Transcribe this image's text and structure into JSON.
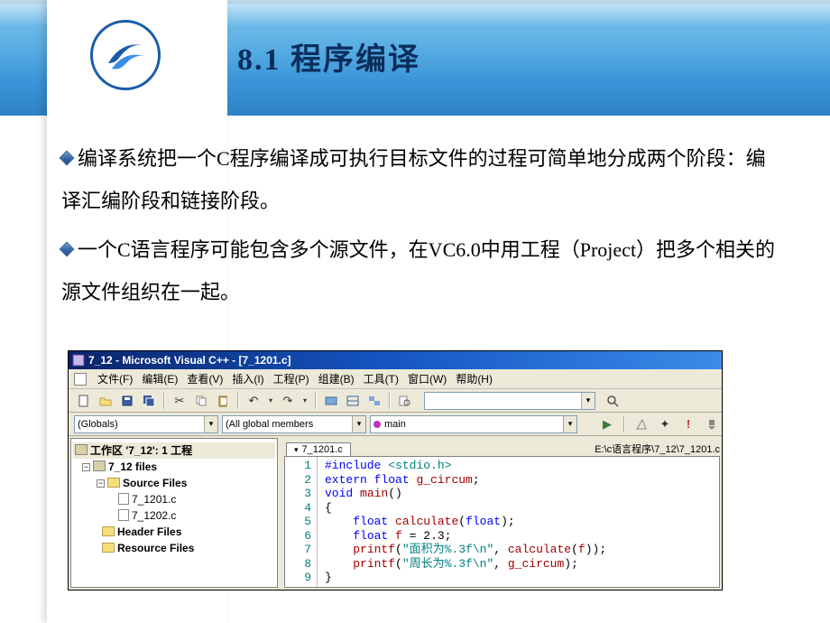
{
  "slide": {
    "title": "8.1 程序编译",
    "bullets": [
      "编译系统把一个C程序编译成可执行目标文件的过程可简单地分成两个阶段：编译汇编阶段和链接阶段。",
      "一个C语言程序可能包含多个源文件，在VC6.0中用工程（Project）把多个相关的源文件组织在一起。"
    ]
  },
  "ide": {
    "title": "7_12 - Microsoft Visual C++ - [7_1201.c]",
    "menus": {
      "file": "文件(F)",
      "edit": "编辑(E)",
      "view": "查看(V)",
      "insert": "插入(I)",
      "project": "工程(P)",
      "build": "组建(B)",
      "tools": "工具(T)",
      "window": "窗口(W)",
      "help": "帮助(H)"
    },
    "combos": {
      "globals": "(Globals)",
      "members": "(All global members",
      "main": "main"
    },
    "editor_tab": "7_1201.c",
    "editor_path": "E:\\c语言程序\\7_12\\7_1201.c",
    "tree": {
      "workspace": "工作区 '7_12': 1 工程",
      "project": "7_12 files",
      "source_folder": "Source Files",
      "file1": "7_1201.c",
      "file2": "7_1202.c",
      "header_folder": "Header Files",
      "resource_folder": "Resource Files"
    },
    "code_lines": {
      "l1a": "#include",
      "l1b": "<stdio.h>",
      "l2a": "extern float",
      "l2b": "g_circum",
      "l2c": ";",
      "l3a": "void",
      "l3b": "main",
      "l3c": "()",
      "l4": "{",
      "l5a": "float",
      "l5b": "calculate",
      "l5c": "(",
      "l5d": "float",
      "l5e": ");",
      "l6a": "float",
      "l6b": "f",
      "l6c": " = ",
      "l6d": "2.3",
      "l6e": ";",
      "l7a": "printf",
      "l7b": "(",
      "l7c": "\"面积为%.3f\\n\"",
      "l7d": ", ",
      "l7e": "calculate",
      "l7f": "(",
      "l7g": "f",
      "l7h": "));",
      "l8a": "printf",
      "l8b": "(",
      "l8c": "\"周长为%.3f\\n\"",
      "l8d": ", ",
      "l8e": "g_circum",
      "l8f": ");",
      "l9": "}"
    },
    "line_numbers": [
      "1",
      "2",
      "3",
      "4",
      "5",
      "6",
      "7",
      "8",
      "9"
    ]
  }
}
